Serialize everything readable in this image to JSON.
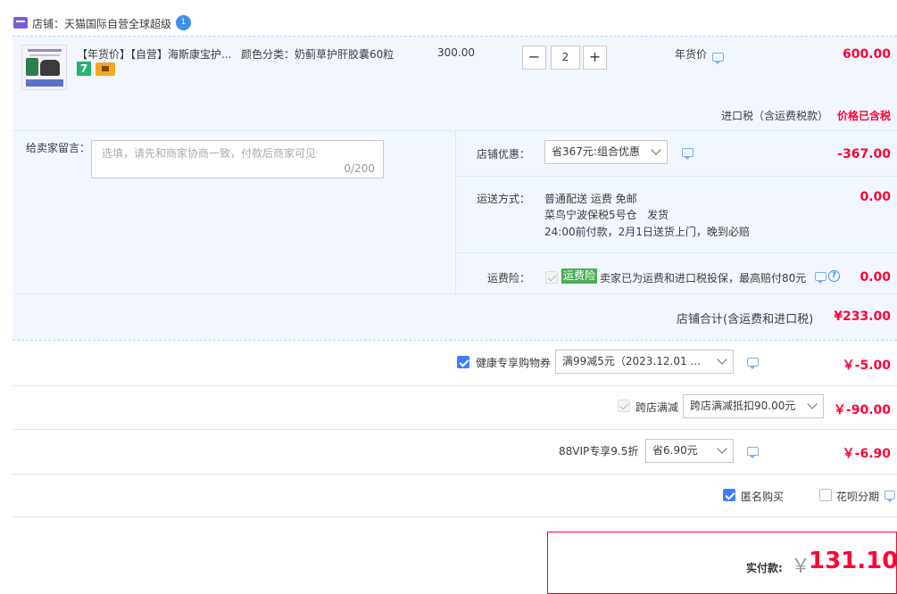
{
  "shop": {
    "label": "店铺：",
    "name": "天猫国际自营全球超级",
    "badge": "1"
  },
  "item": {
    "title": "【年货价】【自营】海斯康宝护...",
    "spec": "颜色分类：奶蓟草护肝胶囊60粒",
    "price": "300.00",
    "qty_minus": "−",
    "qty": "2",
    "qty_plus": "+",
    "promo_label": "年货价",
    "subtotal": "600.00",
    "badge_seven": "7",
    "tax_label": "进口税（含运费税款）",
    "tax_value": "价格已含税"
  },
  "message": {
    "label": "给卖家留言：",
    "placeholder": "选填，请先和商家协商一致，付款后商家可见",
    "counter": "0/200"
  },
  "shop_coupon": {
    "label": "店铺优惠：",
    "value": "省367元:组合优惠",
    "amount": "-367.00"
  },
  "shipping": {
    "label": "运送方式：",
    "line1": "普通配送 运费 免邮",
    "line2": "菜鸟宁波保税5号仓   发货",
    "line3": "24:00前付款，2月1日送货上门，晚到必赔",
    "amount": "0.00"
  },
  "insurance": {
    "label": "运费险：",
    "tag": "运费险",
    "text": "卖家已为运费和进口税投保，最高赔付80元",
    "amount": "0.00"
  },
  "shop_total": {
    "label": "店铺合计(含运费和进口税)",
    "amount": "¥233.00"
  },
  "health_coupon": {
    "label": "健康专享购物券",
    "value": "满99减5元（2023.12.01 ...",
    "amount": "￥-5.00"
  },
  "cross_shop": {
    "label": "跨店满减",
    "value": "跨店满减抵扣90.00元",
    "amount": "￥-90.00"
  },
  "vip": {
    "label": "88VIP专享9.5折",
    "value": "省6.90元",
    "amount": "￥-6.90"
  },
  "options": {
    "anonymous": "匿名购买",
    "huabei": "花呗分期"
  },
  "payment": {
    "label": "实付款:",
    "currency": "￥",
    "amount": "131.10"
  },
  "colors": {
    "accent_red": "#ff0036",
    "accent_blue": "#3d7eff",
    "panel_bg": "#f2f7ff",
    "insurance_green": "#4cad5a"
  }
}
